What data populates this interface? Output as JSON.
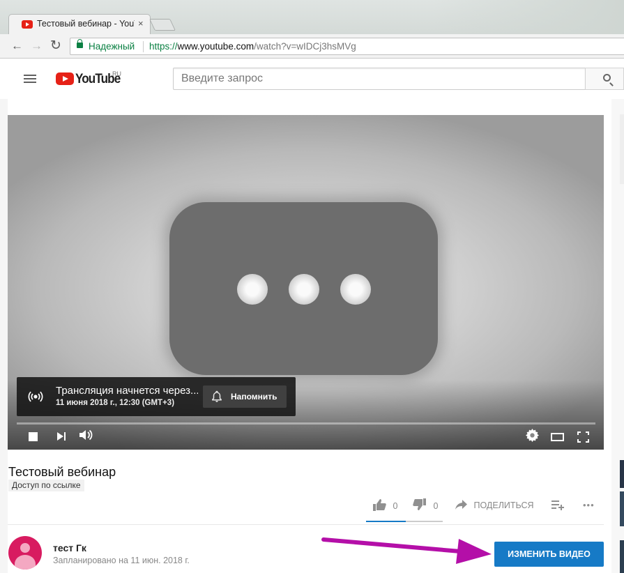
{
  "browser": {
    "tab_title": "Тестовый вебинар - YouTube",
    "tab_close": "×",
    "secure_label": "Надежный",
    "url_scheme": "https://",
    "url_domain": "www.youtube.com",
    "url_path": "/watch?v=wIDCj3hsMVg",
    "back": "←",
    "forward": "→",
    "reload": "↻"
  },
  "youtube": {
    "logo_text": "YouTube",
    "logo_region": "RU",
    "search_placeholder": "Введите запрос"
  },
  "player": {
    "live_title": "Трансляция начнется через...",
    "live_date": "11 июня 2018 г., 12:30 (GMT+3)",
    "remind_label": "Напомнить",
    "icons": [
      "stop-icon",
      "next-icon",
      "volume-icon",
      "settings-gear-icon",
      "theater-mode-icon",
      "fullscreen-icon"
    ]
  },
  "video": {
    "title": "Тестовый вебинар",
    "privacy": "Доступ по ссылке",
    "likes": "0",
    "dislikes": "0",
    "share_label": "ПОДЕЛИТЬСЯ",
    "more": "•••"
  },
  "channel": {
    "name": "тест Гк",
    "scheduled": "Запланировано на 11 июн. 2018 г.",
    "edit_label": "ИЗМЕНИТЬ ВИДЕО"
  },
  "colors": {
    "accent": "#167ac6",
    "brand_red": "#e62117",
    "annotation_arrow": "#b40fa8",
    "avatar": "#d81b60"
  }
}
